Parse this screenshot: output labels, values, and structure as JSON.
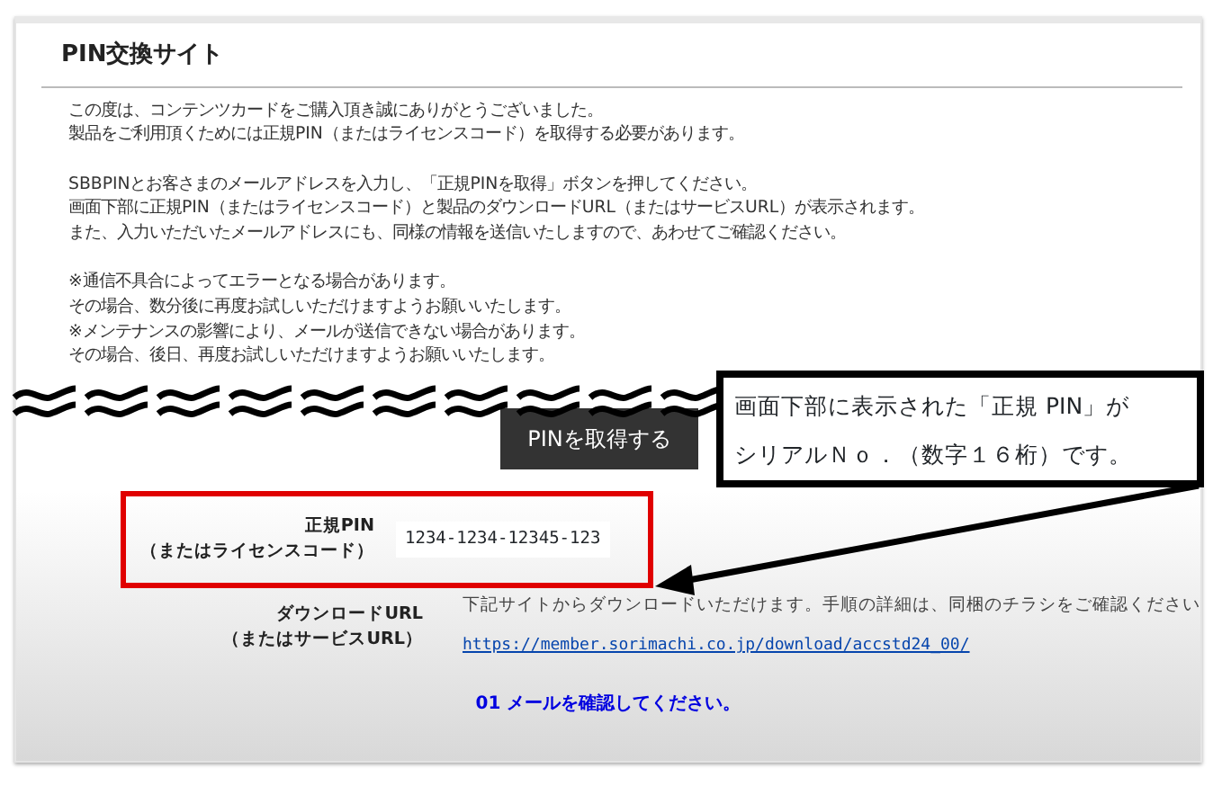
{
  "page": {
    "title": "PIN交換サイト",
    "paragraphs": [
      [
        "この度は、コンテンツカードをご購入頂き誠にありがとうございました。",
        "製品をご利用頂くためには正規PIN（またはライセンスコード）を取得する必要があります。"
      ],
      [
        "SBBPINとお客さまのメールアドレスを入力し、「正規PINを取得」ボタンを押してください。",
        "画面下部に正規PIN（またはライセンスコード）と製品のダウンロードURL（またはサービスURL）が表示されます。",
        "また、入力いただいたメールアドレスにも、同様の情報を送信いたしますので、あわせてご確認ください。"
      ],
      [
        "※通信不具合によってエラーとなる場合があります。",
        "その場合、数分後に再度お試しいただけますようお願いいたします。",
        "※メンテナンスの影響により、メールが送信できない場合があります。",
        "その場合、後日、再度お試しいただけますようお願いいたします。"
      ]
    ],
    "submit_button": "PINを取得する",
    "results": [
      {
        "label": [
          "正規PIN",
          "（またはライセンスコード）"
        ],
        "value": "1234-1234-12345-123",
        "highlighted": true
      },
      {
        "label": [
          "ダウンロードURL",
          "（またはサービスURL）"
        ],
        "note": "下記サイトからダウンロードいただけます。手順の詳細は、同梱のチラシをご確認ください",
        "link": "https://member.sorimachi.co.jp/download/accstd24_00/"
      }
    ],
    "status_message": "01 メールを確認してください。"
  },
  "callout": {
    "lines": [
      "画面下部に表示された「正規 PIN」が",
      "シリアルＮｏ．（数字１６桁）です。"
    ]
  }
}
